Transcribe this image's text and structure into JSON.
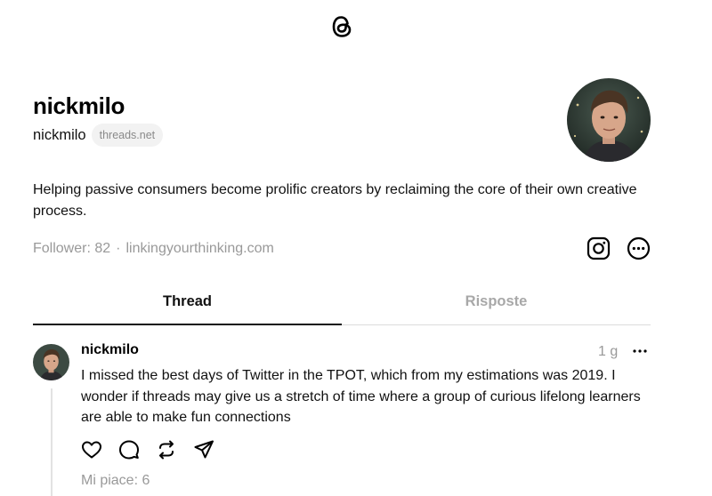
{
  "app": {
    "logo_icon": "threads-logo-icon"
  },
  "profile": {
    "name": "nickmilo",
    "handle": "nickmilo",
    "domain_badge": "threads.net",
    "avatar_icon": "profile-photo",
    "bio": "Helping passive consumers become prolific creators by reclaiming the core of their own creative process.",
    "followers_text": "Follower: 82",
    "separator": "·",
    "link": "linkingyourthinking.com",
    "icons": [
      "instagram-icon",
      "more-options-icon"
    ]
  },
  "tabs": [
    {
      "label": "Thread",
      "active": true
    },
    {
      "label": "Risposte",
      "active": false
    }
  ],
  "post": {
    "author": "nickmilo",
    "time": "1 g",
    "text": "I missed the best days of Twitter in the TPOT, which from my estimations was 2019. I wonder if threads may give us a stretch of time where a group of curious lifelong learners are able to make fun connections",
    "actions": [
      "heart-icon",
      "comment-icon",
      "repost-icon",
      "share-icon"
    ],
    "likes_text": "Mi piace: 6"
  },
  "colors": {
    "text": "#111111",
    "muted": "#999999",
    "pill_bg": "#f2f2f2",
    "divider": "#dcdcdc"
  }
}
